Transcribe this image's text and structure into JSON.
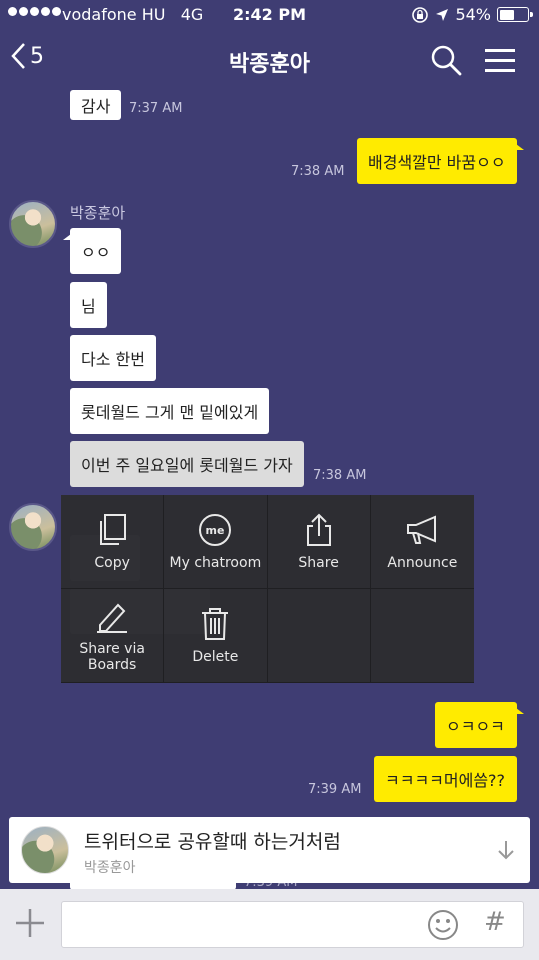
{
  "status_bar": {
    "carrier": "vodafone HU",
    "network": "4G",
    "time": "2:42 PM",
    "battery": "54%",
    "battery_level": 0.54
  },
  "header": {
    "back_count": "5",
    "title": "박종훈아"
  },
  "messages": {
    "m1_text": "감사",
    "m1_time": "7:37 AM",
    "m2_text": "배경색깔만 바꿈ㅇㅇ",
    "m2_time": "7:38 AM",
    "sender_name": "박종훈아",
    "g1": "ㅇㅇ",
    "g2": "님",
    "g3": "다소 한번",
    "g4": "롯데월드 그게 맨 밑에있게",
    "g5": "이번 주 일요일에 롯데월드 가자",
    "g5_time": "7:38 AM",
    "m3_text": "ㅇㅋㅇㅋ",
    "m4_text": "ㅋㅋㅋㅋ머에씀??",
    "m4_time": "7:39 AM",
    "hidden_time": "7:39 AM"
  },
  "context_menu": {
    "copy": "Copy",
    "my_chatroom": "My chatroom",
    "share": "Share",
    "announce": "Announce",
    "share_boards": "Share via\nBoards",
    "delete": "Delete",
    "me_glyph": "me"
  },
  "notice": {
    "text": "트위터으로 공유할때 하는거처럼",
    "sender": "박종훈아"
  },
  "input": {
    "hash": "#"
  }
}
